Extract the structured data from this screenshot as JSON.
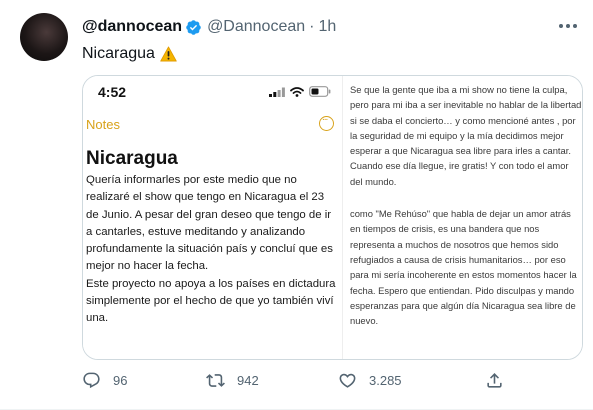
{
  "user": {
    "display_name": "@dannocean",
    "handle": "@Dannocean",
    "separator": "·",
    "time": "1h"
  },
  "tweet": {
    "text": "Nicaragua"
  },
  "screenshot_left": {
    "phone_time": "4:52",
    "back_label": "Notes",
    "title": "Nicaragua",
    "paragraphs": [
      "Quería informarles por este medio que no realizaré  el show que tengo en Nicaragua el 23 de Junio. A pesar del gran deseo que tengo de ir a cantarles, estuve meditando y analizando profundamente la situación país y concluí que es mejor no hacer la fecha.",
      "Este proyecto no apoya a los países en dictadura simplemente por el hecho de que yo también viví una."
    ]
  },
  "screenshot_right": {
    "paragraphs": [
      "Se que la gente que iba a mi show no tiene la culpa, pero para mi iba a ser inevitable no hablar de la libertad si se daba el concierto… y como mencioné antes , por la seguridad de mi equipo y la mía decidimos mejor esperar a que Nicaragua sea libre para irles a cantar. Cuando ese día llegue, ire gratis! Y con todo el amor del mundo.",
      "como \"Me Rehúso\" que habla de dejar un amor atrás en tiempos de crisis, es una bandera que nos representa a muchos de nosotros que hemos sido refugiados a causa de crisis humanitarios… por eso para mi sería incoherente en estos momentos hacer la fecha. Espero que entiendan. Pido disculpas y mando esperanzas para que algún día Nicaragua sea libre de nuevo."
    ]
  },
  "actions": {
    "replies": "96",
    "retweets": "942",
    "likes": "3.285"
  },
  "icons": {
    "verified": "verified-badge-icon",
    "warning": "warning-emoji-icon",
    "more": "more-options-icon",
    "reply": "reply-icon",
    "retweet": "retweet-icon",
    "like": "heart-icon",
    "share": "share-icon"
  },
  "colors": {
    "verified": "#1d9bf0",
    "muted": "#536471",
    "notes_accent": "#d8a21a"
  }
}
